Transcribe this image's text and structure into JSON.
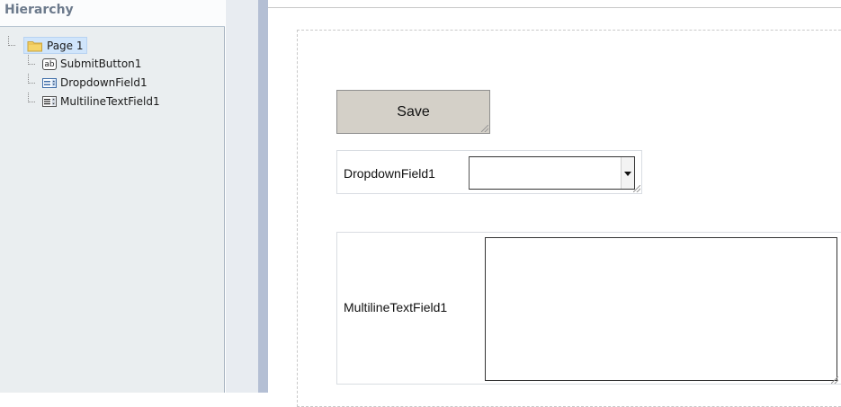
{
  "hierarchy": {
    "title": "Hierarchy",
    "root": {
      "label": "Page 1",
      "icon": "folder-icon"
    },
    "children": [
      {
        "label": "SubmitButton1",
        "icon": "text-button-icon",
        "icon_text": "ab"
      },
      {
        "label": "DropdownField1",
        "icon": "dropdown-field-icon"
      },
      {
        "label": "MultilineTextField1",
        "icon": "multiline-text-icon"
      }
    ]
  },
  "canvas": {
    "save_button": {
      "label": "Save"
    },
    "dropdown_field": {
      "label": "DropdownField1",
      "value": ""
    },
    "multiline_field": {
      "label": "MultilineTextField1",
      "value": ""
    }
  },
  "colors": {
    "panel_bg": "#eaeef0",
    "title_text": "#6c7a8c",
    "selection_bg": "#d0e5fb",
    "button_face": "#d4d0c8",
    "separator_bar": "#b4bfd4",
    "folder_yellow": "#f5d46a"
  }
}
